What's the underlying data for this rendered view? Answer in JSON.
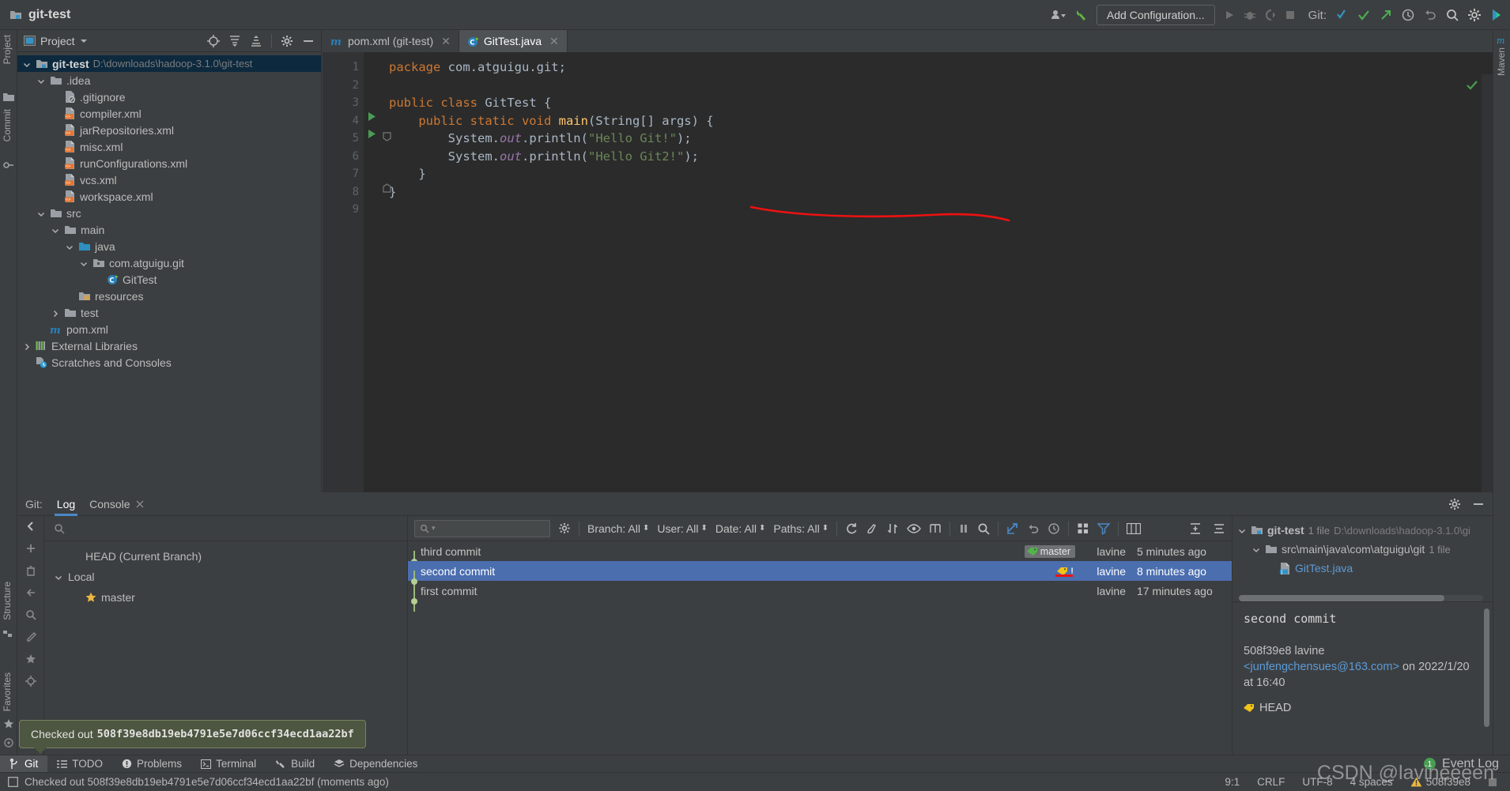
{
  "titlebar": {
    "project_name": "git-test",
    "run_config_placeholder": "Add Configuration...",
    "git_label": "Git:",
    "icons": [
      "user-avatar-icon",
      "hammer-icon",
      "run-icon",
      "debug-icon",
      "run-coverage-icon",
      "stop-icon",
      "git-update-icon",
      "git-commit-icon",
      "git-push-icon",
      "history-icon",
      "rollback-icon",
      "search-everywhere-icon",
      "settings-icon",
      "ide-help-icon"
    ]
  },
  "left_strip": {
    "items": [
      "Project",
      "Commit",
      "Structure",
      "Favorites"
    ]
  },
  "right_strip": {
    "items": [
      "Maven"
    ]
  },
  "project_panel": {
    "title": "Project",
    "tree": [
      {
        "label": "git-test",
        "sub": "D:\\downloads\\hadoop-3.1.0\\git-test",
        "depth": 0,
        "icon": "module-folder-icon",
        "expanded": true,
        "selected": true,
        "bold": true
      },
      {
        "label": ".idea",
        "sub": "",
        "depth": 1,
        "icon": "folder-icon",
        "expanded": true,
        "selected": false,
        "bold": false
      },
      {
        "label": ".gitignore",
        "sub": "",
        "depth": 2,
        "icon": "gitignore-file-icon",
        "expanded": null,
        "selected": false,
        "bold": false
      },
      {
        "label": "compiler.xml",
        "sub": "",
        "depth": 2,
        "icon": "xml-file-icon",
        "expanded": null,
        "selected": false,
        "bold": false
      },
      {
        "label": "jarRepositories.xml",
        "sub": "",
        "depth": 2,
        "icon": "xml-file-icon",
        "expanded": null,
        "selected": false,
        "bold": false
      },
      {
        "label": "misc.xml",
        "sub": "",
        "depth": 2,
        "icon": "xml-file-icon",
        "expanded": null,
        "selected": false,
        "bold": false
      },
      {
        "label": "runConfigurations.xml",
        "sub": "",
        "depth": 2,
        "icon": "xml-file-icon",
        "expanded": null,
        "selected": false,
        "bold": false
      },
      {
        "label": "vcs.xml",
        "sub": "",
        "depth": 2,
        "icon": "xml-file-icon",
        "expanded": null,
        "selected": false,
        "bold": false
      },
      {
        "label": "workspace.xml",
        "sub": "",
        "depth": 2,
        "icon": "xml-file-icon",
        "expanded": null,
        "selected": false,
        "bold": false
      },
      {
        "label": "src",
        "sub": "",
        "depth": 1,
        "icon": "folder-icon",
        "expanded": true,
        "selected": false,
        "bold": false
      },
      {
        "label": "main",
        "sub": "",
        "depth": 2,
        "icon": "folder-icon",
        "expanded": true,
        "selected": false,
        "bold": false
      },
      {
        "label": "java",
        "sub": "",
        "depth": 3,
        "icon": "source-folder-icon",
        "expanded": true,
        "selected": false,
        "bold": false
      },
      {
        "label": "com.atguigu.git",
        "sub": "",
        "depth": 4,
        "icon": "package-icon",
        "expanded": true,
        "selected": false,
        "bold": false
      },
      {
        "label": "GitTest",
        "sub": "",
        "depth": 5,
        "icon": "java-class-icon",
        "expanded": null,
        "selected": false,
        "bold": false
      },
      {
        "label": "resources",
        "sub": "",
        "depth": 3,
        "icon": "resources-folder-icon",
        "expanded": null,
        "selected": false,
        "bold": false
      },
      {
        "label": "test",
        "sub": "",
        "depth": 2,
        "icon": "folder-icon",
        "expanded": false,
        "selected": false,
        "bold": false
      },
      {
        "label": "pom.xml",
        "sub": "",
        "depth": 1,
        "icon": "maven-file-icon",
        "expanded": null,
        "selected": false,
        "bold": false
      },
      {
        "label": "External Libraries",
        "sub": "",
        "depth": 0,
        "icon": "libraries-icon",
        "expanded": false,
        "selected": false,
        "bold": false
      },
      {
        "label": "Scratches and Consoles",
        "sub": "",
        "depth": 0,
        "icon": "scratches-icon",
        "expanded": null,
        "selected": false,
        "bold": false
      }
    ]
  },
  "editor": {
    "tabs": [
      {
        "label": "pom.xml (git-test)",
        "icon": "maven-file-icon",
        "active": false
      },
      {
        "label": "GitTest.java",
        "icon": "java-class-icon",
        "active": true
      }
    ],
    "line_numbers": [
      "1",
      "2",
      "3",
      "4",
      "5",
      "6",
      "7",
      "8",
      "9"
    ],
    "code": [
      [
        {
          "t": "package ",
          "c": "kw"
        },
        {
          "t": "com.atguigu.git;",
          "c": "pln"
        }
      ],
      [],
      [
        {
          "t": "public class ",
          "c": "kw"
        },
        {
          "t": "GitTest",
          "c": "cls"
        },
        {
          "t": " {",
          "c": "pln"
        }
      ],
      [
        {
          "t": "    public static void ",
          "c": "kw"
        },
        {
          "t": "main",
          "c": "mth"
        },
        {
          "t": "(String[] args) {",
          "c": "pln"
        }
      ],
      [
        {
          "t": "        System.",
          "c": "pln"
        },
        {
          "t": "out",
          "c": "fld"
        },
        {
          "t": ".println(",
          "c": "pln"
        },
        {
          "t": "\"Hello Git!\"",
          "c": "str"
        },
        {
          "t": ");",
          "c": "pln"
        }
      ],
      [
        {
          "t": "        System.",
          "c": "pln"
        },
        {
          "t": "out",
          "c": "fld"
        },
        {
          "t": ".println(",
          "c": "pln"
        },
        {
          "t": "\"Hello Git2!\"",
          "c": "str"
        },
        {
          "t": ");",
          "c": "pln"
        }
      ],
      [
        {
          "t": "    }",
          "c": "pln"
        }
      ],
      [
        {
          "t": "}",
          "c": "pln"
        }
      ],
      []
    ],
    "run_marker_lines": [
      3,
      4
    ]
  },
  "git_panel": {
    "label": "Git:",
    "tabs": [
      {
        "label": "Log",
        "active": true,
        "closable": false
      },
      {
        "label": "Console",
        "active": false,
        "closable": true
      }
    ],
    "branch_search_placeholder": "",
    "branches": [
      {
        "label": "HEAD (Current Branch)",
        "depth": 1,
        "icon": "",
        "chev": null
      },
      {
        "label": "Local",
        "depth": 0,
        "icon": "",
        "chev": true
      },
      {
        "label": "master",
        "depth": 1,
        "icon": "star-icon",
        "chev": null
      }
    ],
    "log_toolbar": {
      "search_placeholder": "",
      "filters": [
        {
          "label": "Branch: All"
        },
        {
          "label": "User: All"
        },
        {
          "label": "Date: All"
        },
        {
          "label": "Paths: All"
        }
      ],
      "icons": [
        "refresh-icon",
        "history-brush-icon",
        "sort-icon",
        "eye-icon",
        "intellisort-icon",
        "pause-icon",
        "search-icon",
        "go-to-icon",
        "undo-icon",
        "clock-icon",
        "columns-icon",
        "filter-icon",
        "diff-preview-icon",
        "expand-icon",
        "collapse-icon"
      ]
    },
    "commits": [
      {
        "subject": "third commit",
        "tag": "master",
        "tag_icon": "green-label-icon",
        "author": "lavine",
        "date": "5 minutes ago",
        "selected": false
      },
      {
        "subject": "second commit",
        "tag": "!",
        "tag_icon": "yellow-label-icon",
        "author": "lavine",
        "date": "8 minutes ago",
        "selected": true
      },
      {
        "subject": "first commit",
        "tag": "",
        "tag_icon": "",
        "author": "lavine",
        "date": "17 minutes ago",
        "selected": false
      }
    ],
    "details": {
      "files_tree": [
        {
          "label": "git-test",
          "count": "1 file",
          "path": "D:\\downloads\\hadoop-3.1.0\\gi",
          "depth": 0,
          "icon": "module-folder-icon",
          "chev": true
        },
        {
          "label": "src\\main\\java\\com\\atguigu\\git",
          "count": "1 file",
          "path": "",
          "depth": 1,
          "icon": "folder-icon",
          "chev": true
        },
        {
          "label": "GitTest.java",
          "count": "",
          "path": "",
          "depth": 2,
          "icon": "java-file-icon",
          "chev": null
        }
      ],
      "subject": "second commit",
      "hash": "508f39e8",
      "author": "lavine",
      "email": "<junfengchensues@163.com>",
      "on_text": "on 2022/1/20",
      "at_text": "at 16:40",
      "head_label": "HEAD"
    }
  },
  "toast": {
    "prefix": "Checked out",
    "hash": "508f39e8db19eb4791e5e7d06ccf34ecd1aa22bf"
  },
  "bottom_bar": {
    "buttons": [
      {
        "label": "Git",
        "icon": "git-branch-icon",
        "active": true
      },
      {
        "label": "TODO",
        "icon": "todo-icon",
        "active": false
      },
      {
        "label": "Problems",
        "icon": "problems-icon",
        "active": false
      },
      {
        "label": "Terminal",
        "icon": "terminal-icon",
        "active": false
      },
      {
        "label": "Build",
        "icon": "build-hammer-icon",
        "active": false
      },
      {
        "label": "Dependencies",
        "icon": "dependencies-icon",
        "active": false
      }
    ],
    "event_log": {
      "label": "Event Log",
      "badge": "1"
    }
  },
  "status_bar": {
    "message": "Checked out 508f39e8db19eb4791e5e7d06ccf34ecd1aa22bf (moments ago)",
    "caret": "9:1",
    "line_sep": "CRLF",
    "encoding": "UTF-8",
    "indent": "4 spaces",
    "branch": "508f39e8"
  },
  "watermark": "CSDN @lavineeeen",
  "colors": {
    "panel_bg": "#3c3f41",
    "editor_bg": "#2b2b2b",
    "selection_blue": "#4b6eaf",
    "tree_selection": "#0d293e",
    "accent_blue": "#4a88c7",
    "green": "#499c54",
    "annotation_red": "#ee1111",
    "toast_bg": "#4d5640"
  }
}
